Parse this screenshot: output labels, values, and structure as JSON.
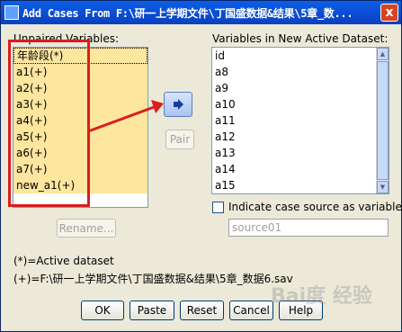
{
  "window": {
    "title": "Add Cases From F:\\研一上学期文件\\丁国盛数据&结果\\5章_数...",
    "close_label": "x"
  },
  "unpaired": {
    "label": "Unpaired Variables:",
    "items": [
      "年龄段(*)",
      "a1(+)",
      "a2(+)",
      "a3(+)",
      "a4(+)",
      "a5(+)",
      "a6(+)",
      "a7(+)",
      "new_a1(+)"
    ]
  },
  "dataset": {
    "label": "Variables in New Active Dataset:",
    "items": [
      "id",
      "a8",
      "a9",
      "a10",
      "a11",
      "a12",
      "a13",
      "a14",
      "a15"
    ]
  },
  "buttons": {
    "rename": "Rename...",
    "pair": "Pair",
    "ok": "OK",
    "paste": "Paste",
    "reset": "Reset",
    "cancel": "Cancel",
    "help": "Help"
  },
  "source": {
    "checkbox_label": "Indicate case source as variable:",
    "value": "source01"
  },
  "notes": {
    "active": "(*)=Active dataset",
    "other": "(+)=F:\\研一上学期文件\\丁国盛数据&结果\\5章_数据6.sav"
  },
  "watermark": "Bai度 经验",
  "colors": {
    "highlight": "#fde69e",
    "annotation": "#d81e1e",
    "title_bar": "#0a3fc1"
  }
}
